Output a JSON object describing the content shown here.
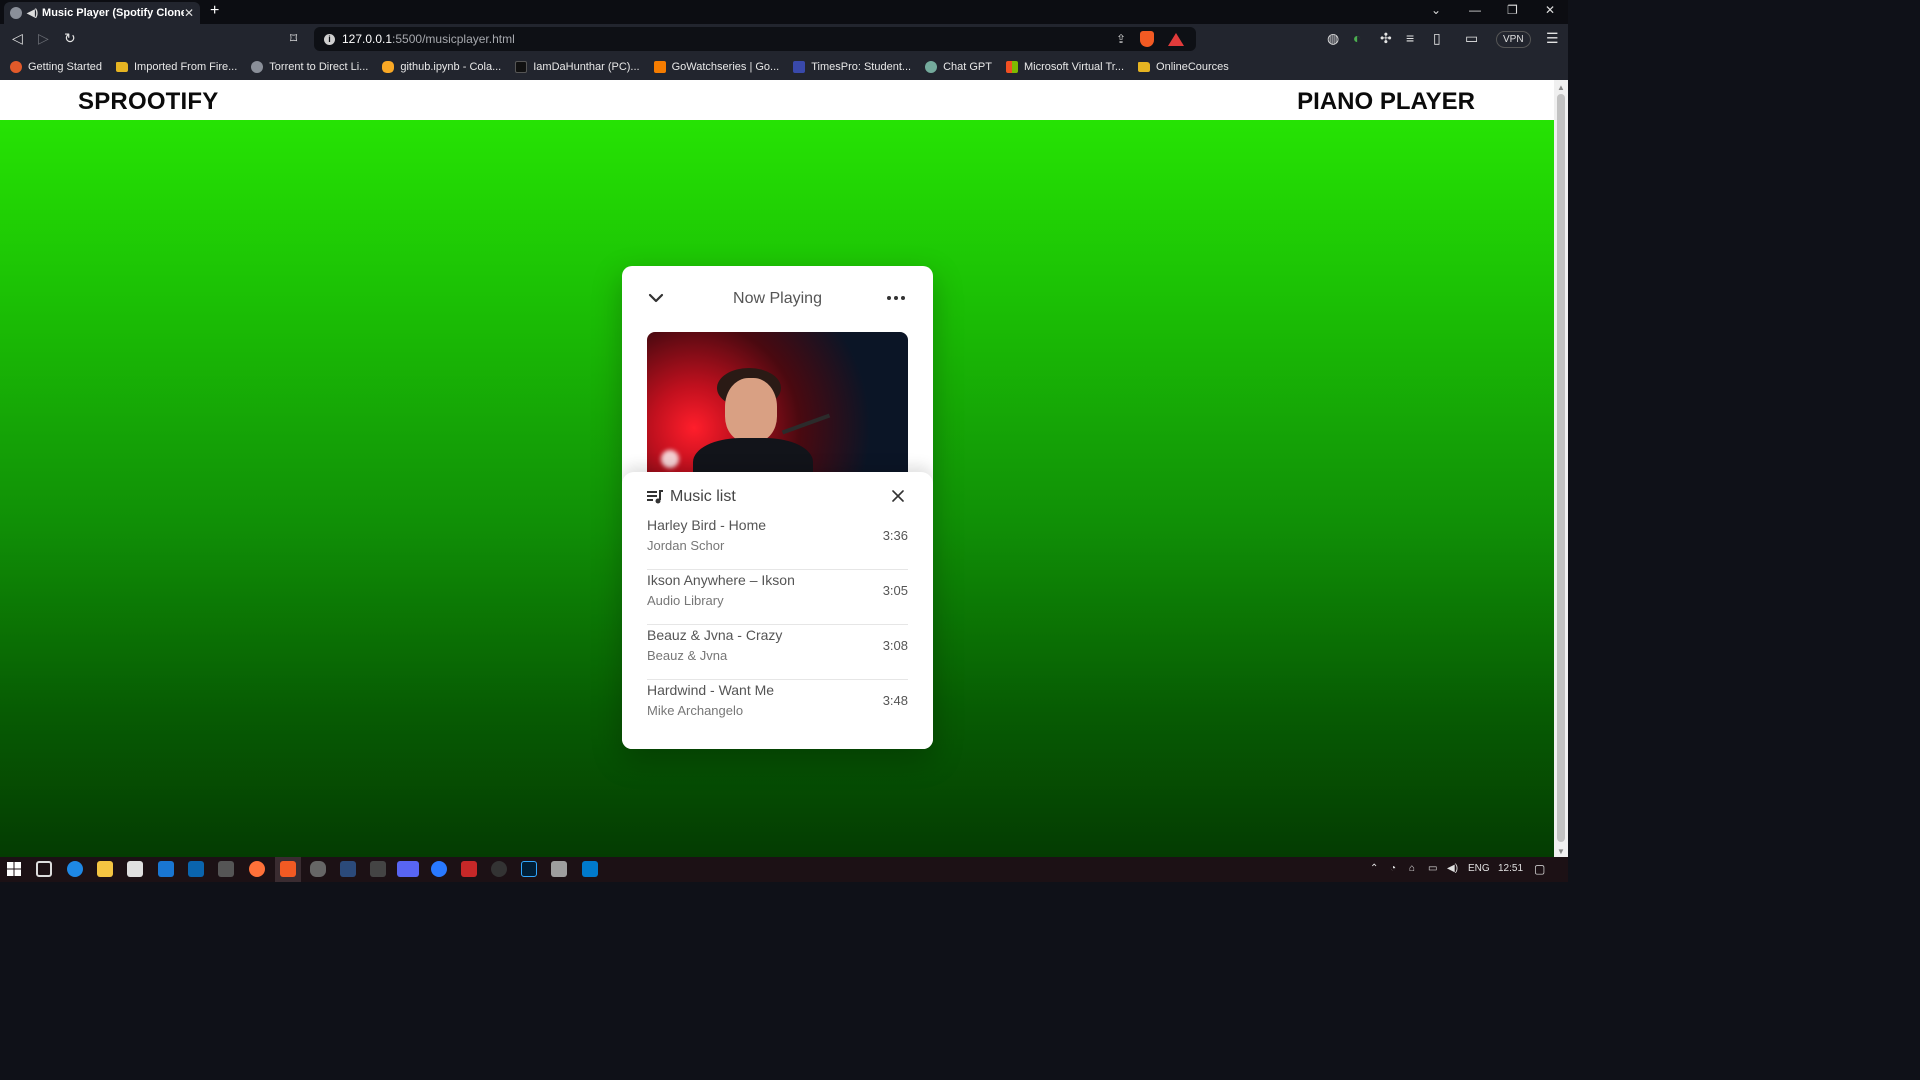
{
  "browser": {
    "tab_title": "Music Player (Spotify Clone)",
    "tab_close": "✕",
    "new_tab": "+",
    "url_host": "127.0.0.1",
    "url_path": ":5500/musicplayer.html",
    "vpn_label": "VPN",
    "bookmarks": [
      {
        "label": "Getting Started",
        "icon": "firefox-icon",
        "color": "#e25a2a"
      },
      {
        "label": "Imported From Fire...",
        "icon": "folder-icon",
        "color": "#e6b422"
      },
      {
        "label": "Torrent to Direct Li...",
        "icon": "globe-icon",
        "color": "#8a8f99"
      },
      {
        "label": "github.ipynb - Cola...",
        "icon": "colab-icon",
        "color": "#f9a825"
      },
      {
        "label": "IamDaHunthar (PC)...",
        "icon": "avatar-icon",
        "color": "#111111"
      },
      {
        "label": "GoWatchseries | Go...",
        "icon": "gowatch-icon",
        "color": "#f57c00"
      },
      {
        "label": "TimesPro: Student...",
        "icon": "timespro-icon",
        "color": "#1a237e"
      },
      {
        "label": "Chat GPT",
        "icon": "chatgpt-icon",
        "color": "#74aa9c"
      },
      {
        "label": "Microsoft Virtual Tr...",
        "icon": "microsoft-icon",
        "color": "#f25022"
      },
      {
        "label": "OnlineCources",
        "icon": "folder-icon",
        "color": "#e6b422"
      }
    ]
  },
  "site": {
    "brand": "SPROOTIFY",
    "nav_link": "PIANO PLAYER"
  },
  "player": {
    "header_title": "Now Playing",
    "list_title": "Music list",
    "tracks": [
      {
        "name": "Harley Bird - Home",
        "artist": "Jordan Schor",
        "duration": "3:36"
      },
      {
        "name": "Ikson Anywhere – Ikson",
        "artist": "Audio Library",
        "duration": "3:05"
      },
      {
        "name": "Beauz & Jvna - Crazy",
        "artist": "Beauz & Jvna",
        "duration": "3:08"
      },
      {
        "name": "Hardwind - Want Me",
        "artist": "Mike Archangelo",
        "duration": "3:48"
      }
    ]
  },
  "taskbar": {
    "lang": "ENG",
    "time": "12:51"
  },
  "colors": {
    "gradient_top": "#26e304",
    "gradient_bottom": "#043c02"
  }
}
